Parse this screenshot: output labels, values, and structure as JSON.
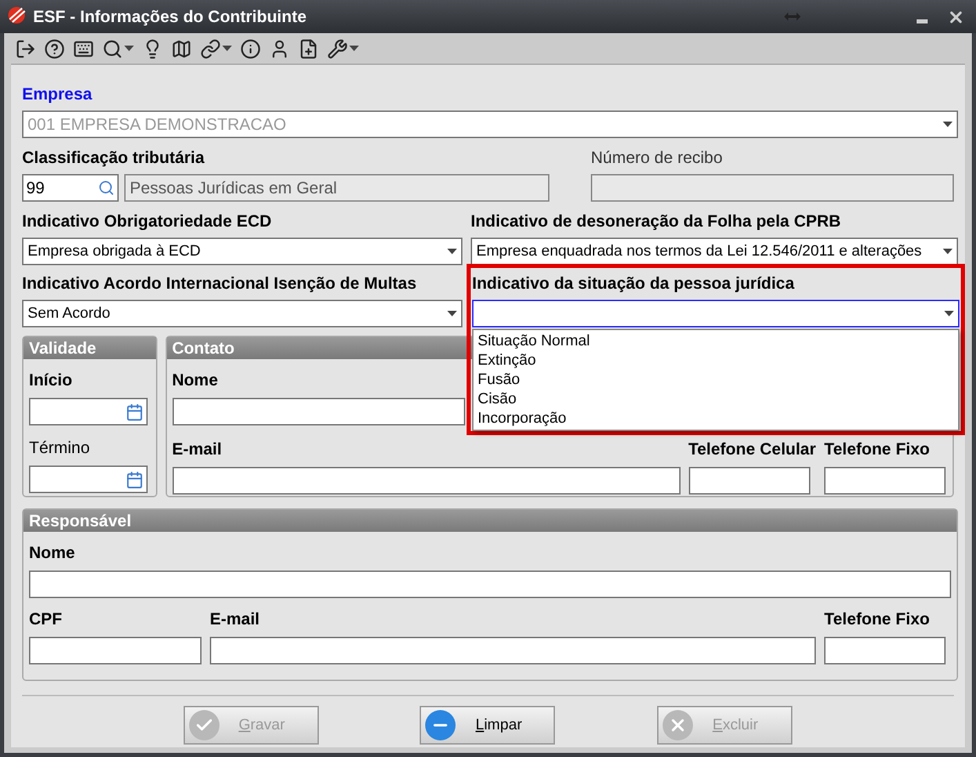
{
  "window": {
    "title": "ESF - Informações do Contribuinte"
  },
  "empresa": {
    "label": "Empresa",
    "value": "001 EMPRESA DEMONSTRACAO",
    "disabled": true
  },
  "classificacao": {
    "label": "Classificação tributária",
    "code": "99",
    "description": "Pessoas Jurídicas em Geral"
  },
  "recibo": {
    "label": "Número de recibo"
  },
  "ecd": {
    "label": "Indicativo Obrigatoriedade ECD",
    "value": "Empresa obrigada à ECD"
  },
  "desoneracao": {
    "label": "Indicativo de desoneração da  Folha pela CPRB",
    "value": "Empresa enquadrada nos termos da Lei 12.546/2011 e alterações"
  },
  "acordo": {
    "label": "Indicativo Acordo Internacional Isenção de Multas",
    "value": "Sem Acordo"
  },
  "situacao": {
    "label": "Indicativo da situação da pessoa jurídica",
    "open": true,
    "highlighted": true,
    "options": [
      "Situação Normal",
      "Extinção",
      "Fusão",
      "Cisão",
      "Incorporação"
    ]
  },
  "validade": {
    "title": "Validade",
    "inicio": "Início",
    "termino": "Término"
  },
  "contato": {
    "title": "Contato",
    "nome": "Nome",
    "email": "E-mail",
    "celular": "Telefone Celular",
    "fixo": "Telefone Fixo"
  },
  "responsavel": {
    "title": "Responsável",
    "nome": "Nome",
    "cpf": "CPF",
    "email": "E-mail",
    "fixo": "Telefone Fixo"
  },
  "buttons": [
    {
      "label": "Gravar",
      "kind": "check",
      "disabled": true
    },
    {
      "label": "Limpar",
      "kind": "minus",
      "disabled": false
    },
    {
      "label": "Excluir",
      "kind": "x",
      "disabled": true
    }
  ]
}
